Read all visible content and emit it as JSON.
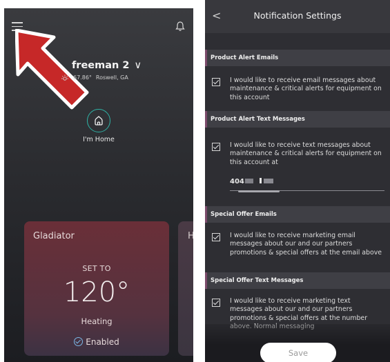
{
  "left_screen": {
    "device": {
      "name": "freeman 2",
      "chevron": "∨",
      "temperature": "67.86°",
      "location": "Roswell, GA"
    },
    "home_mode_label": "I'm Home",
    "card": {
      "title": "Gladiator",
      "set_to": "SET TO",
      "temperature": "120°",
      "mode": "Heating",
      "status": "Enabled"
    },
    "next_card": {
      "title_partial": "H"
    },
    "icons": [
      "menu-icon",
      "bell-icon",
      "sun-icon",
      "home-icon",
      "check-circle-icon"
    ],
    "annotation_color": "#c62828"
  },
  "right_screen": {
    "back_glyph": "<",
    "title": "Notification Settings",
    "sections": [
      {
        "header": "Product Alert Emails",
        "option": "I would like to receive email messages about maintenance & critical alerts for equipment on this account"
      },
      {
        "header": "Product Alert Text Messages",
        "option": "I would like to receive text messages about maintenance & critical alerts for equipment on this account at",
        "phone_prefix": "404"
      },
      {
        "header": "Special Offer Emails",
        "option": "I would like to receive marketing email messages about our and our partners promotions & special offers at the email above"
      },
      {
        "header": "Special Offer Text Messages",
        "option": "I would like to receive marketing text messages about our and our partners promotions & special offers at the number above. Normal messaging"
      }
    ],
    "save_label": "Save",
    "accent_color": "#7a4a6a"
  }
}
